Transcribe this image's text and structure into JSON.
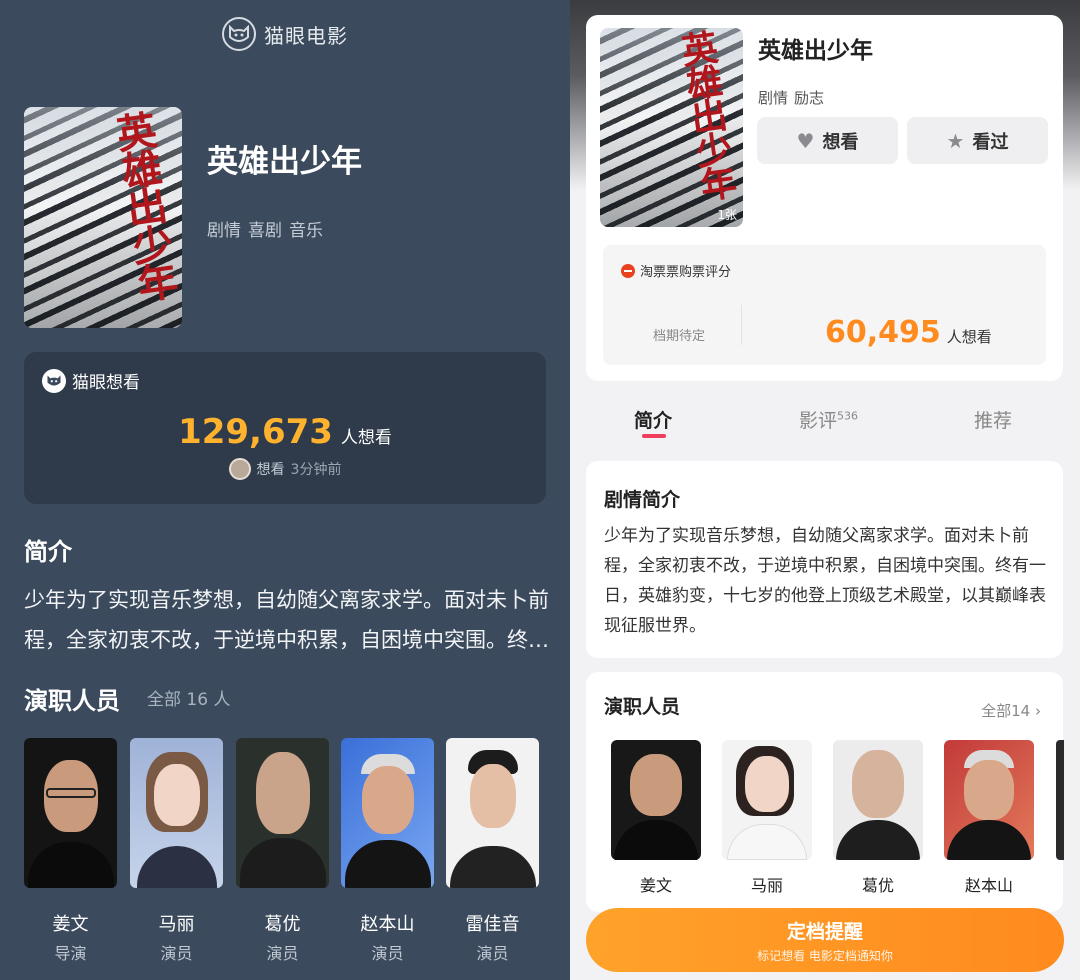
{
  "left": {
    "brand_name": "猫眼电影",
    "title": "英雄出少年",
    "poster_title_art": "英雄出少年",
    "genres": [
      "剧情",
      "喜剧",
      "音乐"
    ],
    "want_card": {
      "label": "猫眼想看",
      "count": "129,673",
      "unit": "人想看",
      "recent_action": "想看",
      "recent_time": "3分钟前"
    },
    "intro_heading": "简介",
    "intro_text": "少年为了实现音乐梦想，自幼随父离家求学。面对未卜前程，全家初衷不改，于逆境中积累，自困境中突围。终有一日，英雄豹变，十七岁的他登上顶级艺术殿堂，以其巅峰表现征服世界。",
    "cast_heading": "演职人员",
    "cast_all": "全部 16 人",
    "cast": [
      {
        "name": "姜文",
        "role": "导演"
      },
      {
        "name": "马丽",
        "role": "演员"
      },
      {
        "name": "葛优",
        "role": "演员"
      },
      {
        "name": "赵本山",
        "role": "演员"
      },
      {
        "name": "雷佳音",
        "role": "演员"
      }
    ]
  },
  "right": {
    "title": "英雄出少年",
    "genres": [
      "剧情",
      "励志"
    ],
    "poster_count": "1张",
    "want_button": "想看",
    "seen_button": "看过",
    "rating_label": "淘票票购票评分",
    "rating_status": "档期待定",
    "want_count": "60,495",
    "want_unit": "人想看",
    "tabs": [
      {
        "label": "简介",
        "badge": ""
      },
      {
        "label": "影评",
        "badge": "536"
      },
      {
        "label": "推荐",
        "badge": ""
      }
    ],
    "plot_heading": "剧情简介",
    "plot_text": "少年为了实现音乐梦想，自幼随父离家求学。面对未卜前程，全家初衷不改，于逆境中积累，自困境中突围。终有一日，英雄豹变，十七岁的他登上顶级艺术殿堂，以其巅峰表现征服世界。",
    "cast_heading": "演职人员",
    "cast_all": "全部14 ›",
    "cast": [
      {
        "name": "姜文"
      },
      {
        "name": "马丽"
      },
      {
        "name": "葛优"
      },
      {
        "name": "赵本山"
      }
    ],
    "cta_main": "定档提醒",
    "cta_sub": "标记想看 电影定档通知你"
  },
  "colors": {
    "left_bg": "#3b4a5c",
    "accent_orange": "#ffb22d",
    "cta_orange": "#ff8a1e",
    "tab_underline": "#f03d5c"
  },
  "icons": [
    "cat-logo-icon",
    "heart-icon",
    "star-icon",
    "taopiaopiao-icon",
    "chevron-right-icon"
  ]
}
